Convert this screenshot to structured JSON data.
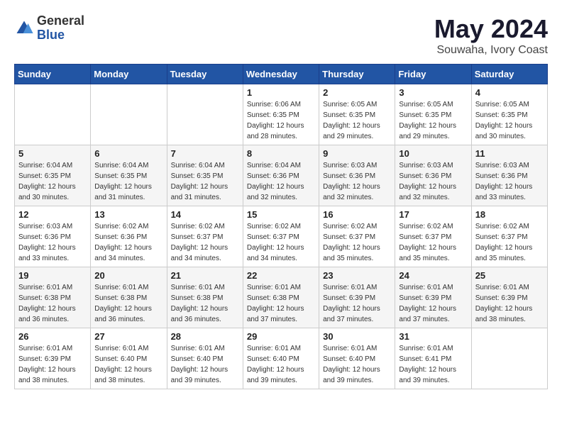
{
  "header": {
    "logo_line1": "General",
    "logo_line2": "Blue",
    "title": "May 2024",
    "subtitle": "Souwaha, Ivory Coast"
  },
  "weekdays": [
    "Sunday",
    "Monday",
    "Tuesday",
    "Wednesday",
    "Thursday",
    "Friday",
    "Saturday"
  ],
  "weeks": [
    [
      {
        "day": "",
        "sunrise": "",
        "sunset": "",
        "daylight": ""
      },
      {
        "day": "",
        "sunrise": "",
        "sunset": "",
        "daylight": ""
      },
      {
        "day": "",
        "sunrise": "",
        "sunset": "",
        "daylight": ""
      },
      {
        "day": "1",
        "sunrise": "Sunrise: 6:06 AM",
        "sunset": "Sunset: 6:35 PM",
        "daylight": "Daylight: 12 hours and 28 minutes."
      },
      {
        "day": "2",
        "sunrise": "Sunrise: 6:05 AM",
        "sunset": "Sunset: 6:35 PM",
        "daylight": "Daylight: 12 hours and 29 minutes."
      },
      {
        "day": "3",
        "sunrise": "Sunrise: 6:05 AM",
        "sunset": "Sunset: 6:35 PM",
        "daylight": "Daylight: 12 hours and 29 minutes."
      },
      {
        "day": "4",
        "sunrise": "Sunrise: 6:05 AM",
        "sunset": "Sunset: 6:35 PM",
        "daylight": "Daylight: 12 hours and 30 minutes."
      }
    ],
    [
      {
        "day": "5",
        "sunrise": "Sunrise: 6:04 AM",
        "sunset": "Sunset: 6:35 PM",
        "daylight": "Daylight: 12 hours and 30 minutes."
      },
      {
        "day": "6",
        "sunrise": "Sunrise: 6:04 AM",
        "sunset": "Sunset: 6:35 PM",
        "daylight": "Daylight: 12 hours and 31 minutes."
      },
      {
        "day": "7",
        "sunrise": "Sunrise: 6:04 AM",
        "sunset": "Sunset: 6:35 PM",
        "daylight": "Daylight: 12 hours and 31 minutes."
      },
      {
        "day": "8",
        "sunrise": "Sunrise: 6:04 AM",
        "sunset": "Sunset: 6:36 PM",
        "daylight": "Daylight: 12 hours and 32 minutes."
      },
      {
        "day": "9",
        "sunrise": "Sunrise: 6:03 AM",
        "sunset": "Sunset: 6:36 PM",
        "daylight": "Daylight: 12 hours and 32 minutes."
      },
      {
        "day": "10",
        "sunrise": "Sunrise: 6:03 AM",
        "sunset": "Sunset: 6:36 PM",
        "daylight": "Daylight: 12 hours and 32 minutes."
      },
      {
        "day": "11",
        "sunrise": "Sunrise: 6:03 AM",
        "sunset": "Sunset: 6:36 PM",
        "daylight": "Daylight: 12 hours and 33 minutes."
      }
    ],
    [
      {
        "day": "12",
        "sunrise": "Sunrise: 6:03 AM",
        "sunset": "Sunset: 6:36 PM",
        "daylight": "Daylight: 12 hours and 33 minutes."
      },
      {
        "day": "13",
        "sunrise": "Sunrise: 6:02 AM",
        "sunset": "Sunset: 6:36 PM",
        "daylight": "Daylight: 12 hours and 34 minutes."
      },
      {
        "day": "14",
        "sunrise": "Sunrise: 6:02 AM",
        "sunset": "Sunset: 6:37 PM",
        "daylight": "Daylight: 12 hours and 34 minutes."
      },
      {
        "day": "15",
        "sunrise": "Sunrise: 6:02 AM",
        "sunset": "Sunset: 6:37 PM",
        "daylight": "Daylight: 12 hours and 34 minutes."
      },
      {
        "day": "16",
        "sunrise": "Sunrise: 6:02 AM",
        "sunset": "Sunset: 6:37 PM",
        "daylight": "Daylight: 12 hours and 35 minutes."
      },
      {
        "day": "17",
        "sunrise": "Sunrise: 6:02 AM",
        "sunset": "Sunset: 6:37 PM",
        "daylight": "Daylight: 12 hours and 35 minutes."
      },
      {
        "day": "18",
        "sunrise": "Sunrise: 6:02 AM",
        "sunset": "Sunset: 6:37 PM",
        "daylight": "Daylight: 12 hours and 35 minutes."
      }
    ],
    [
      {
        "day": "19",
        "sunrise": "Sunrise: 6:01 AM",
        "sunset": "Sunset: 6:38 PM",
        "daylight": "Daylight: 12 hours and 36 minutes."
      },
      {
        "day": "20",
        "sunrise": "Sunrise: 6:01 AM",
        "sunset": "Sunset: 6:38 PM",
        "daylight": "Daylight: 12 hours and 36 minutes."
      },
      {
        "day": "21",
        "sunrise": "Sunrise: 6:01 AM",
        "sunset": "Sunset: 6:38 PM",
        "daylight": "Daylight: 12 hours and 36 minutes."
      },
      {
        "day": "22",
        "sunrise": "Sunrise: 6:01 AM",
        "sunset": "Sunset: 6:38 PM",
        "daylight": "Daylight: 12 hours and 37 minutes."
      },
      {
        "day": "23",
        "sunrise": "Sunrise: 6:01 AM",
        "sunset": "Sunset: 6:39 PM",
        "daylight": "Daylight: 12 hours and 37 minutes."
      },
      {
        "day": "24",
        "sunrise": "Sunrise: 6:01 AM",
        "sunset": "Sunset: 6:39 PM",
        "daylight": "Daylight: 12 hours and 37 minutes."
      },
      {
        "day": "25",
        "sunrise": "Sunrise: 6:01 AM",
        "sunset": "Sunset: 6:39 PM",
        "daylight": "Daylight: 12 hours and 38 minutes."
      }
    ],
    [
      {
        "day": "26",
        "sunrise": "Sunrise: 6:01 AM",
        "sunset": "Sunset: 6:39 PM",
        "daylight": "Daylight: 12 hours and 38 minutes."
      },
      {
        "day": "27",
        "sunrise": "Sunrise: 6:01 AM",
        "sunset": "Sunset: 6:40 PM",
        "daylight": "Daylight: 12 hours and 38 minutes."
      },
      {
        "day": "28",
        "sunrise": "Sunrise: 6:01 AM",
        "sunset": "Sunset: 6:40 PM",
        "daylight": "Daylight: 12 hours and 39 minutes."
      },
      {
        "day": "29",
        "sunrise": "Sunrise: 6:01 AM",
        "sunset": "Sunset: 6:40 PM",
        "daylight": "Daylight: 12 hours and 39 minutes."
      },
      {
        "day": "30",
        "sunrise": "Sunrise: 6:01 AM",
        "sunset": "Sunset: 6:40 PM",
        "daylight": "Daylight: 12 hours and 39 minutes."
      },
      {
        "day": "31",
        "sunrise": "Sunrise: 6:01 AM",
        "sunset": "Sunset: 6:41 PM",
        "daylight": "Daylight: 12 hours and 39 minutes."
      },
      {
        "day": "",
        "sunrise": "",
        "sunset": "",
        "daylight": ""
      }
    ]
  ]
}
